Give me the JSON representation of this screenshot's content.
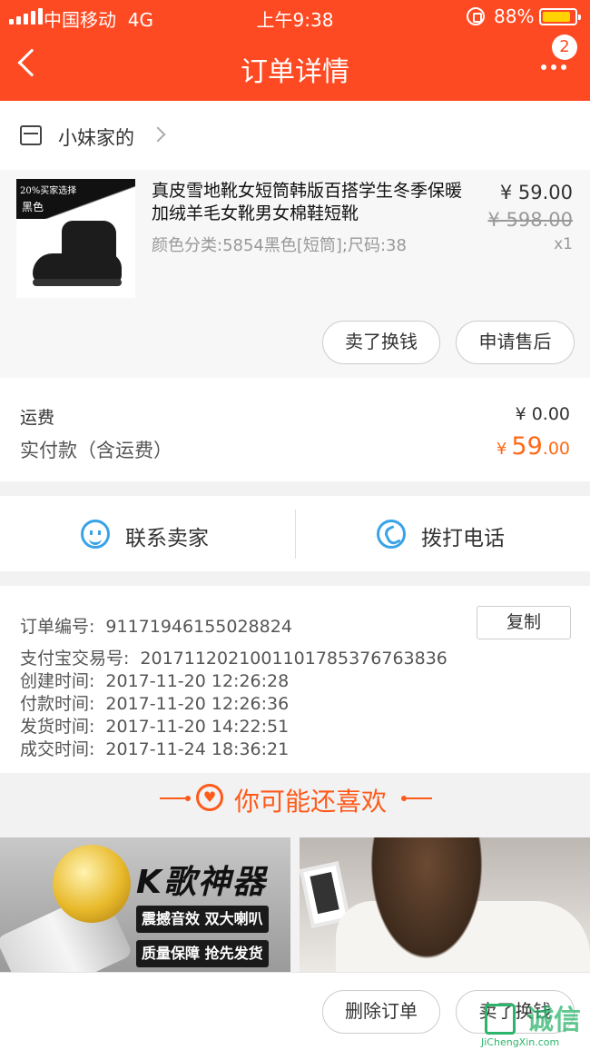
{
  "status_bar": {
    "carrier": "中国移动",
    "network": "4G",
    "time": "上午9:38",
    "battery": "88%"
  },
  "nav": {
    "title": "订单详情",
    "badge_count": "2"
  },
  "shop": {
    "name": "小妹家的"
  },
  "item": {
    "title": "真皮雪地靴女短筒韩版百搭学生冬季保暖加绒羊毛女靴男女棉鞋短靴",
    "spec": "颜色分类:5854黑色[短筒];尺码:38",
    "price": "¥ 59.00",
    "original_price": "¥ 598.00",
    "quantity": "x1",
    "thumb_promo": "20%买家选择",
    "thumb_color": "黑色"
  },
  "item_actions": {
    "sell_label": "卖了换钱",
    "after_sale_label": "申请售后"
  },
  "fees": {
    "shipping_label": "运费",
    "shipping_value": "¥ 0.00",
    "paid_label": "实付款（含运费）",
    "paid_currency": "¥",
    "paid_int": "59",
    "paid_dec": ".00"
  },
  "contact": {
    "seller_label": "联系卖家",
    "phone_label": "拨打电话"
  },
  "order": {
    "number_label": "订单编号:",
    "number": "91171946155028824",
    "copy_label": "复制",
    "alipay_label": "支付宝交易号:",
    "alipay": "2017112021001101785376763836",
    "created_label": "创建时间:",
    "created": "2017-11-20 12:26:28",
    "paid_time_label": "付款时间:",
    "paid_time": "2017-11-20 12:26:36",
    "shipped_label": "发货时间:",
    "shipped": "2017-11-20 14:22:51",
    "completed_label": "成交时间:",
    "completed": "2017-11-24 18:36:21"
  },
  "recommend": {
    "title": "你可能还喜欢",
    "card1_title": "K歌神器",
    "card1_tag1": "震撼音效 双大喇叭",
    "card1_tag2": "质量保障 抢先发货"
  },
  "bottom": {
    "delete_label": "删除订单",
    "sell_label": "卖了换钱"
  },
  "watermark": {
    "text": "诚信",
    "url": "JiChengXin.com"
  },
  "colors": {
    "brand": "#fe4a22",
    "accent_orange": "#fe6a1a",
    "icon_blue": "#39a3e8"
  }
}
